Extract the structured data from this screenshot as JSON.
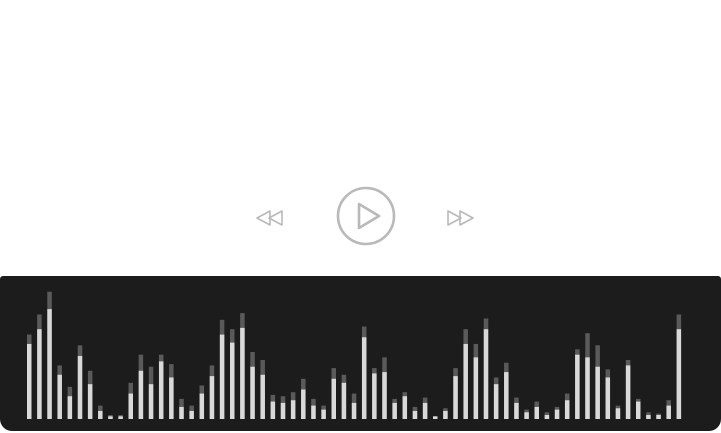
{
  "player": {
    "controls": {
      "rewind_icon": "rewind-icon",
      "play_icon": "play-icon",
      "forward_icon": "fast-forward-icon",
      "icon_color": "#b9b9b9"
    },
    "visualizer": {
      "background": "#1c1c1c",
      "bar_color": "#d9d9d9",
      "peak_color": "#5a5a5a",
      "levels": [
        0.56,
        0.67,
        0.82,
        0.33,
        0.17,
        0.47,
        0.26,
        0.06,
        0.02,
        0.02,
        0.19,
        0.36,
        0.26,
        0.43,
        0.31,
        0.09,
        0.06,
        0.19,
        0.32,
        0.63,
        0.57,
        0.68,
        0.39,
        0.33,
        0.13,
        0.12,
        0.14,
        0.22,
        0.1,
        0.07,
        0.3,
        0.27,
        0.12,
        0.61,
        0.34,
        0.35,
        0.12,
        0.17,
        0.06,
        0.12,
        0.02,
        0.06,
        0.32,
        0.56,
        0.46,
        0.67,
        0.26,
        0.35,
        0.12,
        0.05,
        0.09,
        0.03,
        0.07,
        0.14,
        0.48,
        0.46,
        0.39,
        0.31,
        0.08,
        0.4,
        0.13,
        0.03,
        0.03,
        0.1,
        0.67
      ],
      "peaks": [
        0.63,
        0.78,
        0.95,
        0.4,
        0.24,
        0.55,
        0.36,
        0.1,
        0.03,
        0.03,
        0.27,
        0.48,
        0.39,
        0.48,
        0.41,
        0.15,
        0.1,
        0.25,
        0.4,
        0.74,
        0.67,
        0.79,
        0.5,
        0.44,
        0.18,
        0.17,
        0.2,
        0.3,
        0.15,
        0.1,
        0.38,
        0.33,
        0.19,
        0.69,
        0.38,
        0.46,
        0.15,
        0.2,
        0.09,
        0.16,
        0.02,
        0.08,
        0.38,
        0.67,
        0.56,
        0.75,
        0.31,
        0.42,
        0.16,
        0.07,
        0.13,
        0.05,
        0.09,
        0.19,
        0.52,
        0.64,
        0.55,
        0.37,
        0.1,
        0.44,
        0.15,
        0.05,
        0.04,
        0.14,
        0.78
      ]
    }
  }
}
